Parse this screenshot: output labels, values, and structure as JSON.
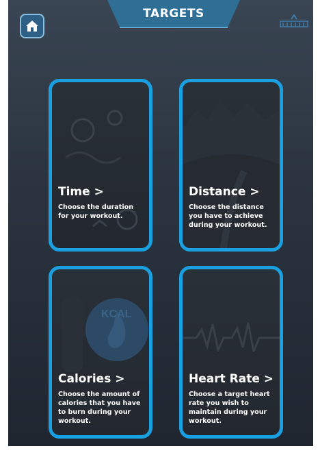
{
  "header": {
    "title": "TARGETS",
    "home_icon": "home-icon",
    "brand_logo": "brand-logo"
  },
  "cards": [
    {
      "title": "Time >",
      "description": "Choose the duration for your workout."
    },
    {
      "title": "Distance >",
      "description": "Choose the distance you have to achieve during your workout."
    },
    {
      "title": "Calories >",
      "description": "Choose the amount of calories that you have to burn during your workout."
    },
    {
      "title": "Heart Rate >",
      "description": "Choose a target heart rate you wish to maintain during your workout."
    }
  ],
  "colors": {
    "accent": "#1aa0e0",
    "background_top": "#3a4553",
    "background_bottom": "#1f2630",
    "title_tab": "#2f6f96"
  }
}
